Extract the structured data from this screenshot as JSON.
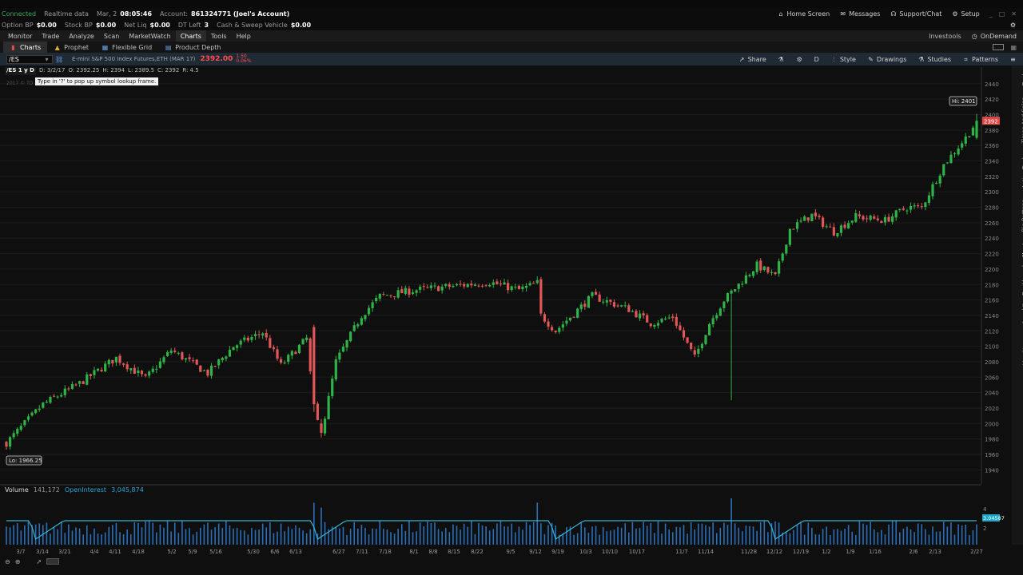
{
  "status": {
    "connection": "Connected",
    "data_mode": "Realtime data",
    "date": "Mar, 2",
    "time": "08:05:46",
    "account_label": "Account:",
    "account_value": "861324771 (Joel's Account)",
    "right_links": [
      "Home Screen",
      "Messages",
      "Support/Chat",
      "Setup"
    ]
  },
  "account": [
    {
      "label": "Option BP",
      "value": "$0.00"
    },
    {
      "label": "Stock BP",
      "value": "$0.00"
    },
    {
      "label": "Net Liq",
      "value": "$0.00"
    },
    {
      "label": "DT Left",
      "value": "3"
    },
    {
      "label": "Cash & Sweep Vehicle",
      "value": "$0.00"
    }
  ],
  "menu": {
    "items": [
      "Monitor",
      "Trade",
      "Analyze",
      "Scan",
      "MarketWatch",
      "Charts",
      "Tools",
      "Help"
    ],
    "active": "Charts",
    "right": [
      "Investools",
      "OnDemand"
    ]
  },
  "subtabs": {
    "items": [
      "Charts",
      "Prophet",
      "Flexible Grid",
      "Product Depth"
    ],
    "active": "Charts"
  },
  "chart_header": {
    "symbol": "/ES",
    "description": "E-mini S&P 500 Index Futures,ETH (MAR 17)",
    "price": "2392.00",
    "change_top": "1.50",
    "change_bottom": "0.06%",
    "tools": [
      "Share",
      "D",
      "Style",
      "Drawings",
      "Studies",
      "Patterns"
    ]
  },
  "ohlc": {
    "symbol": "/ES 1 y D",
    "date": "D: 3/2/17",
    "open": "O: 2392.25",
    "high": "H: 2394",
    "low": "L: 2389.5",
    "close": "C: 2392",
    "range": "R: 4.5"
  },
  "tooltip": "Type in '?' to pop up symbol lookup frame.",
  "copyright": "2017 © TD",
  "side_tabs": [
    "Trade",
    "Times And Sales",
    "Active Trader",
    "Big Buttons",
    "Chart",
    "Dashboard",
    "Level II",
    "Live News"
  ],
  "volume": {
    "label": "Volume",
    "value": "141,172",
    "oi_label": "OpenInterest",
    "oi_value": "3,045,874",
    "marker": "3.04587",
    "scale": [
      "4",
      "2"
    ]
  },
  "chart_data": {
    "type": "candlestick",
    "title": "",
    "price_axis": {
      "min": 1930,
      "max": 2445,
      "ticks": [
        1940,
        1960,
        1980,
        2000,
        2020,
        2040,
        2060,
        2080,
        2100,
        2120,
        2140,
        2160,
        2180,
        2200,
        2220,
        2240,
        2260,
        2280,
        2300,
        2320,
        2340,
        2360,
        2380,
        2400,
        2420,
        2440
      ],
      "last_price": "2392"
    },
    "x_ticks": [
      "3/7",
      "3/14",
      "3/21",
      "4/4",
      "4/11",
      "4/18",
      "5/2",
      "5/9",
      "5/16",
      "5/30",
      "6/6",
      "6/13",
      "6/27",
      "7/11",
      "7/18",
      "8/1",
      "8/8",
      "8/15",
      "8/22",
      "9/5",
      "9/12",
      "9/19",
      "10/3",
      "10/10",
      "10/17",
      "11/7",
      "11/14",
      "11/28",
      "12/12",
      "12/19",
      "1/2",
      "1/9",
      "1/16",
      "2/6",
      "2/13",
      "2/27"
    ],
    "high_label": "Hi: 2401",
    "low_label": "Lo: 1966.25",
    "trend_anchors": [
      [
        0,
        1975
      ],
      [
        10,
        2025
      ],
      [
        20,
        2052
      ],
      [
        30,
        2085
      ],
      [
        38,
        2058
      ],
      [
        45,
        2095
      ],
      [
        55,
        2065
      ],
      [
        62,
        2100
      ],
      [
        70,
        2118
      ],
      [
        75,
        2075
      ],
      [
        82,
        2110
      ],
      [
        84,
        2020
      ],
      [
        86,
        1985
      ],
      [
        90,
        2080
      ],
      [
        97,
        2140
      ],
      [
        102,
        2165
      ],
      [
        112,
        2173
      ],
      [
        122,
        2178
      ],
      [
        132,
        2183
      ],
      [
        140,
        2173
      ],
      [
        145,
        2182
      ],
      [
        146,
        2140
      ],
      [
        150,
        2120
      ],
      [
        160,
        2165
      ],
      [
        170,
        2148
      ],
      [
        176,
        2130
      ],
      [
        182,
        2138
      ],
      [
        188,
        2085
      ],
      [
        192,
        2130
      ],
      [
        196,
        2160
      ],
      [
        205,
        2205
      ],
      [
        210,
        2190
      ],
      [
        214,
        2252
      ],
      [
        220,
        2270
      ],
      [
        226,
        2248
      ],
      [
        232,
        2268
      ],
      [
        240,
        2263
      ],
      [
        246,
        2280
      ],
      [
        250,
        2280
      ],
      [
        256,
        2335
      ],
      [
        262,
        2370
      ],
      [
        265,
        2392
      ]
    ],
    "volume_series": "daily volume histogram with open interest line"
  }
}
